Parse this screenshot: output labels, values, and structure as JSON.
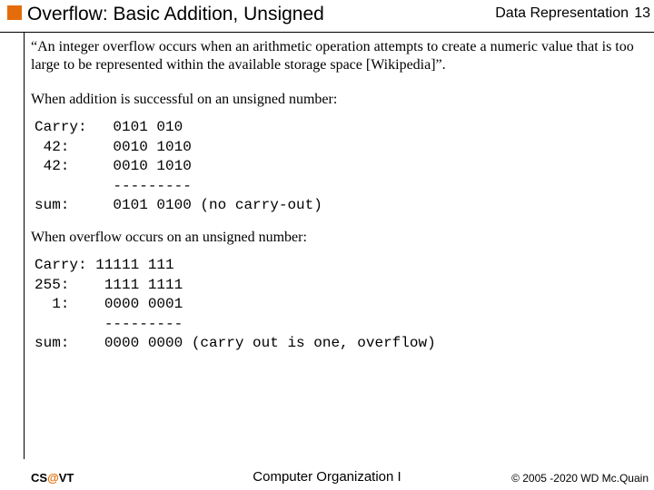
{
  "header": {
    "title": "Overflow: Basic Addition, Unsigned",
    "section": "Data Representation",
    "page": "13"
  },
  "body": {
    "quote": "“An integer overflow occurs when an arithmetic operation attempts to create a numeric value that is too large to be represented within the available storage space [Wikipedia]”.",
    "para1": "When addition is successful on an unsigned number:",
    "code1": "Carry:   0101 010\n 42:     0010 1010\n 42:     0010 1010\n         ---------\nsum:     0101 0100 (no carry-out)",
    "para2": "When overflow occurs on an unsigned number:",
    "code2": "Carry: 11111 111\n255:    1111 1111\n  1:    0000 0001\n        ---------\nsum:    0000 0000 (carry out is one, overflow)"
  },
  "footer": {
    "left_prefix": "CS",
    "left_at": "@",
    "left_suffix": "VT",
    "center": "Computer Organization I",
    "right": "© 2005 -2020  WD Mc.Quain"
  }
}
